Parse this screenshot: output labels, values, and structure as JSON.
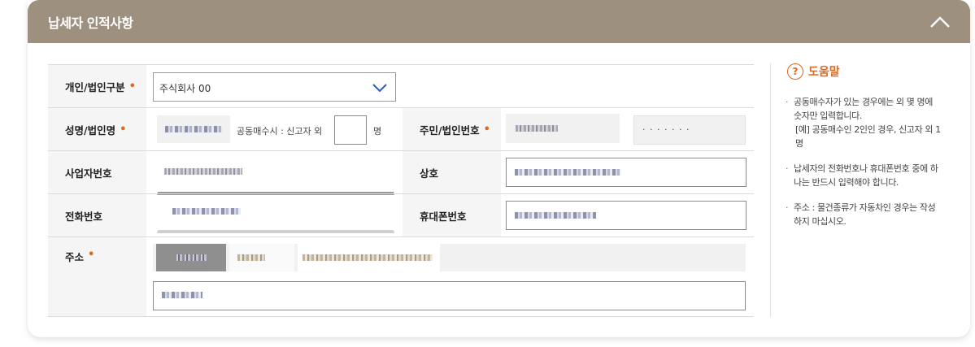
{
  "header": {
    "title": "납세자 인적사항",
    "collapse_icon": "chevron-up-icon"
  },
  "form": {
    "type": {
      "label": "개인/법인구분",
      "value": "주식회사 00",
      "chevron_icon": "chevron-down-icon"
    },
    "name": {
      "label": "성명/법인명",
      "co_owner_text": "공동매수시 : 신고자 외",
      "co_owner_count": "",
      "unit": "명"
    },
    "id_number": {
      "label": "주민/법인번호",
      "masked_value": "· · · · · · ·"
    },
    "biz_number": {
      "label": "사업자번호"
    },
    "company": {
      "label": "상호"
    },
    "phone": {
      "label": "전화번호"
    },
    "mobile": {
      "label": "휴대폰번호"
    },
    "address": {
      "label": "주소"
    },
    "required_mark": "•"
  },
  "help": {
    "icon": "question-circle-icon",
    "icon_glyph": "?",
    "title": "도움말",
    "items": [
      {
        "text": "공동매수자가 있는 경우에는 외 몇 명에 숫자만 입력합니다.",
        "sub": "[예] 공동매수인 2인인 경우, 신고자 외 1명"
      },
      {
        "text": "납세자의 전화번호나 휴대폰번호 중에 하나는 반드시 입력해야 합니다."
      },
      {
        "text": "주소 : 물건종류가 자동차인 경우는 작성하지 마십시오."
      }
    ]
  },
  "colors": {
    "header_bg": "#9d907e",
    "accent": "#e0671b"
  }
}
